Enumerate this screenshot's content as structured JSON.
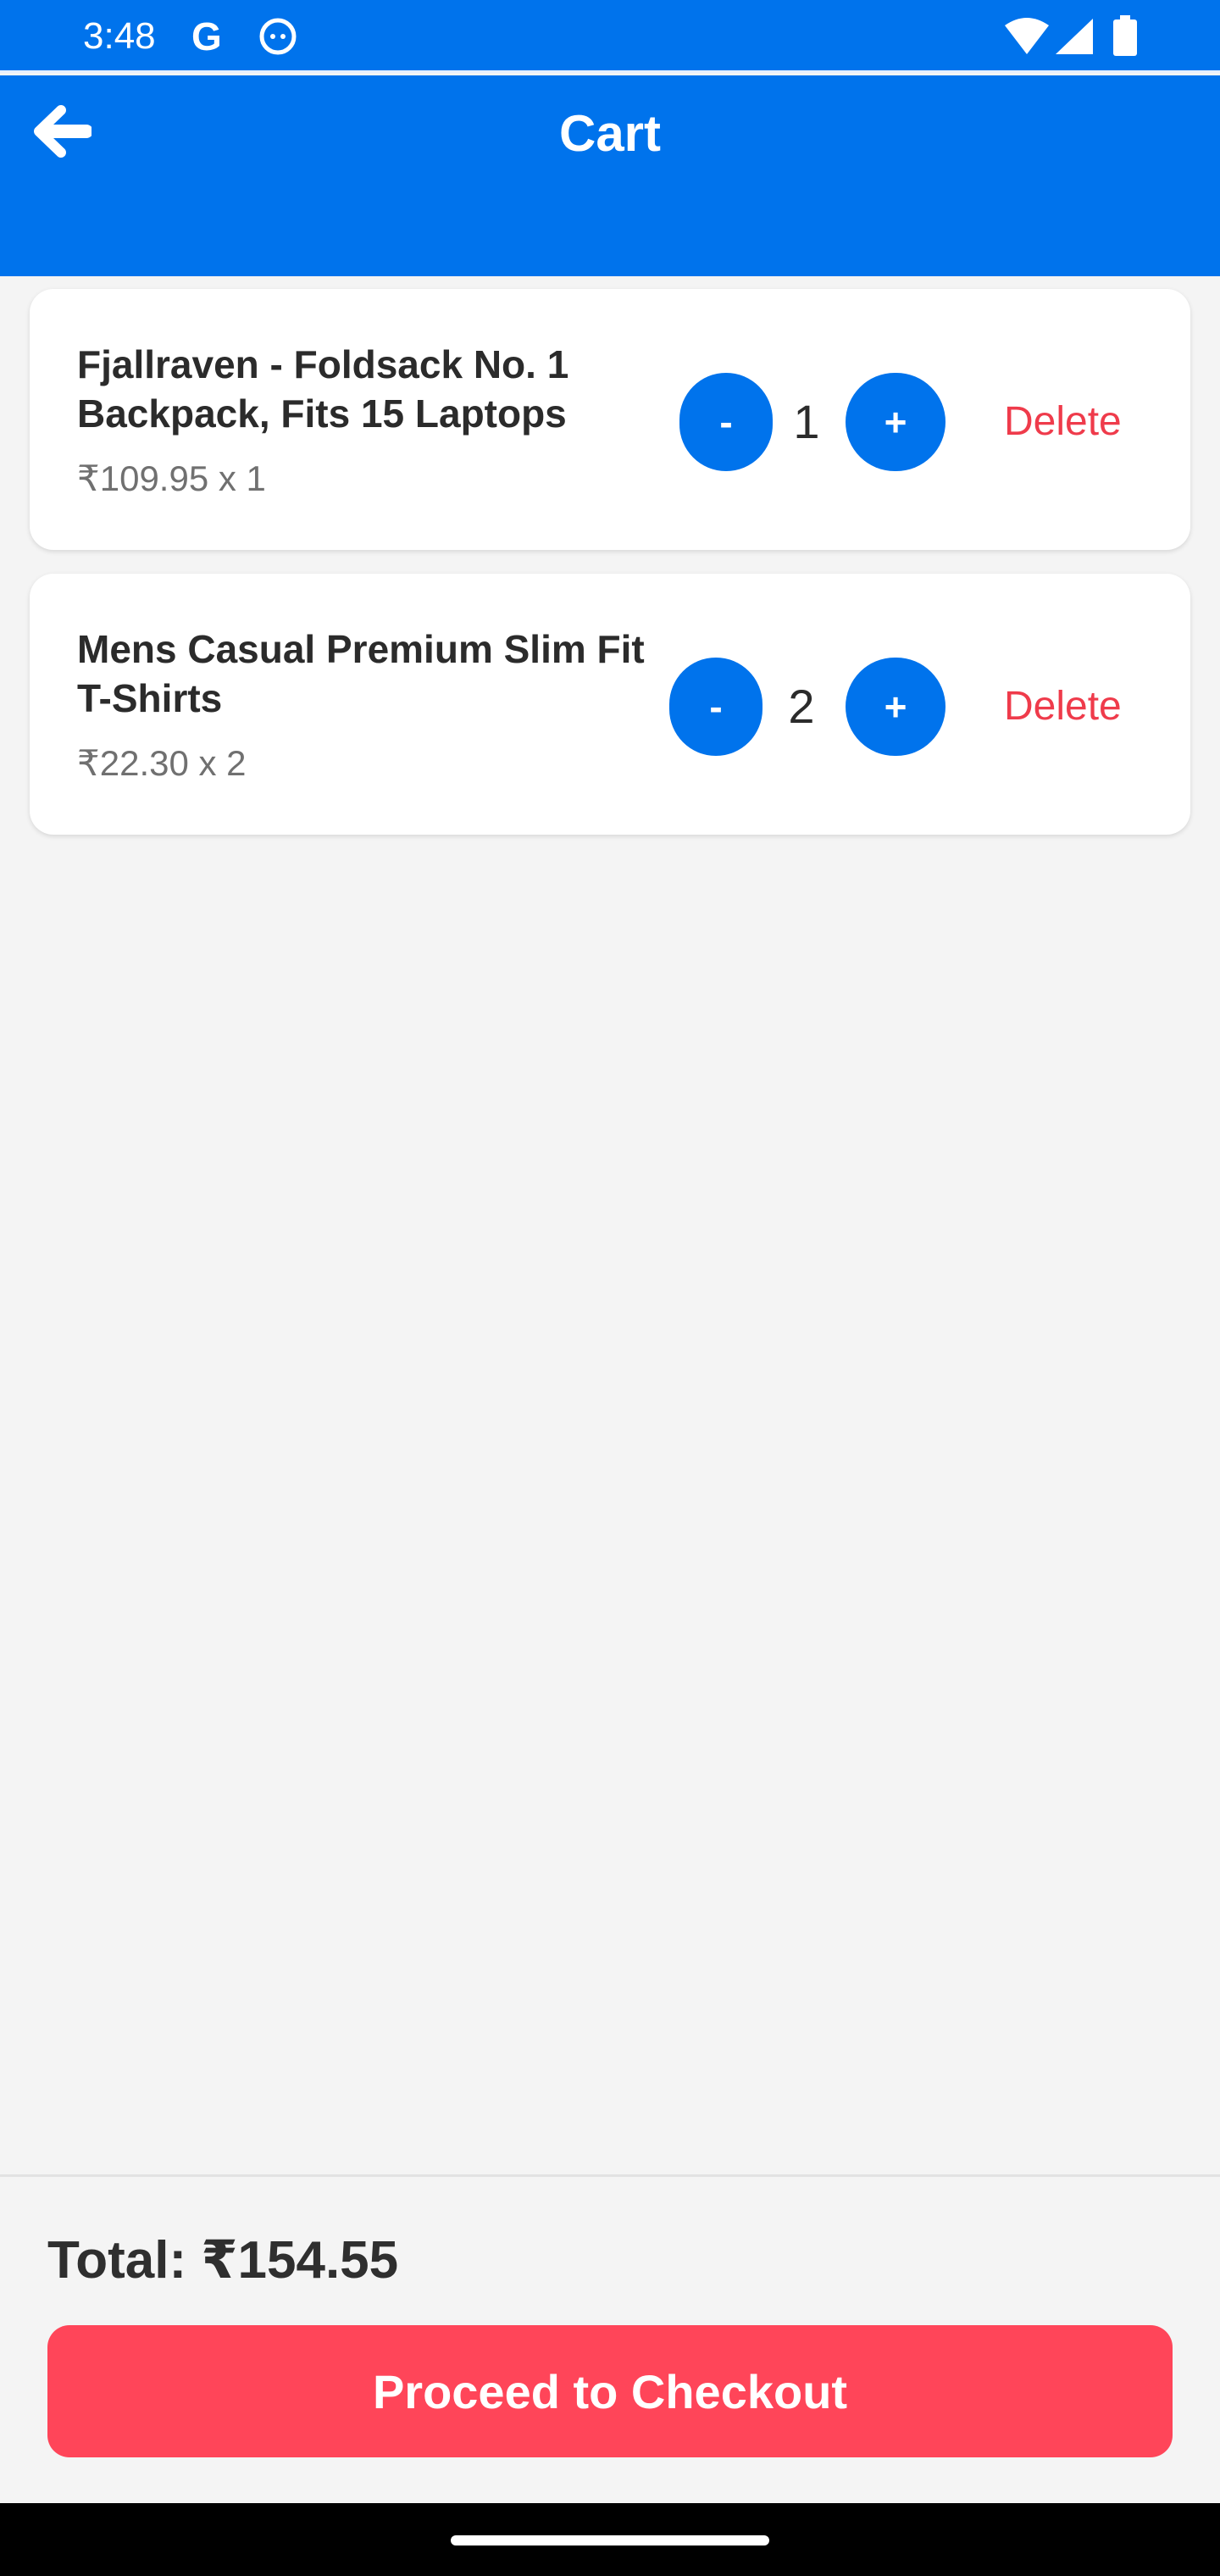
{
  "status_bar": {
    "time": "3:48",
    "google_letter": "G",
    "icons": [
      "google-icon",
      "cat-icon",
      "wifi-icon",
      "signal-icon",
      "battery-icon"
    ]
  },
  "header": {
    "title": "Cart",
    "back_icon": "arrow-left-icon"
  },
  "cart": {
    "items": [
      {
        "title": "Fjallraven - Foldsack No. 1 Backpack, Fits 15 Laptops",
        "price_line": "₹109.95 x 1",
        "minus_label": "-",
        "quantity": "1",
        "plus_label": "+",
        "delete_label": "Delete"
      },
      {
        "title": "Mens Casual Premium Slim Fit T-Shirts",
        "price_line": "₹22.30 x 2",
        "minus_label": "-",
        "quantity": "2",
        "plus_label": "+",
        "delete_label": "Delete"
      }
    ]
  },
  "footer": {
    "total": "Total: ₹154.55",
    "checkout_label": "Proceed to Checkout"
  },
  "colors": {
    "primary": "#0073ec",
    "danger": "#ef3b4b",
    "checkout": "#ff4559",
    "background": "#f4f4f4"
  }
}
